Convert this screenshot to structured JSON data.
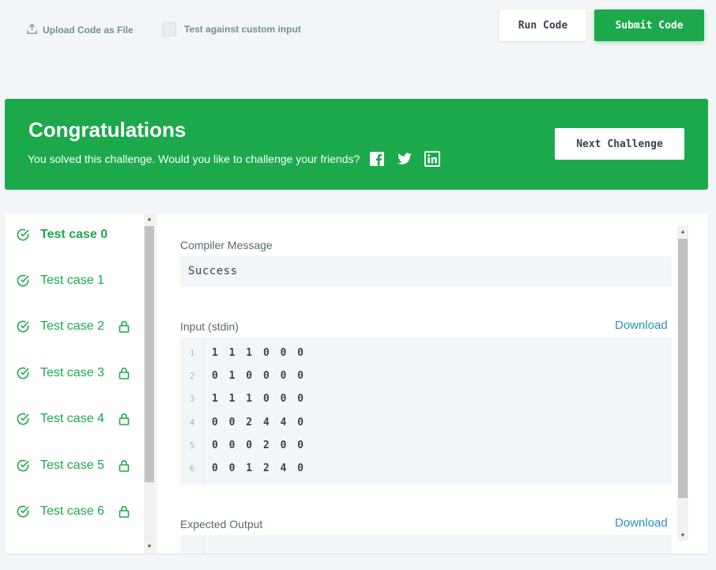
{
  "toolbar": {
    "upload_label": "Upload Code as File",
    "custom_input_label": "Test against custom input",
    "run_label": "Run Code",
    "submit_label": "Submit Code"
  },
  "banner": {
    "title": "Congratulations",
    "subtitle": "You solved this challenge. Would you like to challenge your friends?",
    "social_icons": [
      "facebook-icon",
      "twitter-icon",
      "linkedin-icon"
    ],
    "next_label": "Next Challenge"
  },
  "test_cases": [
    {
      "label": "Test case 0",
      "locked": false,
      "active": true
    },
    {
      "label": "Test case 1",
      "locked": false,
      "active": false
    },
    {
      "label": "Test case 2",
      "locked": true,
      "active": false
    },
    {
      "label": "Test case 3",
      "locked": true,
      "active": false
    },
    {
      "label": "Test case 4",
      "locked": true,
      "active": false
    },
    {
      "label": "Test case 5",
      "locked": true,
      "active": false
    },
    {
      "label": "Test case 6",
      "locked": true,
      "active": false
    }
  ],
  "result": {
    "compiler_label": "Compiler Message",
    "compiler_message": "Success",
    "input_label": "Input (stdin)",
    "download_label": "Download",
    "input_lines": [
      {
        "num": "1",
        "text": "1 1 1 0 0 0"
      },
      {
        "num": "2",
        "text": "0 1 0 0 0 0"
      },
      {
        "num": "3",
        "text": "1 1 1 0 0 0"
      },
      {
        "num": "4",
        "text": "0 0 2 4 4 0"
      },
      {
        "num": "5",
        "text": "0 0 0 2 0 0"
      },
      {
        "num": "6",
        "text": "0 0 1 2 4 0"
      }
    ],
    "expected_label": "Expected Output"
  },
  "colors": {
    "accent": "#1ba94c",
    "link": "#2a8fc8",
    "background": "#f3f6f8"
  }
}
